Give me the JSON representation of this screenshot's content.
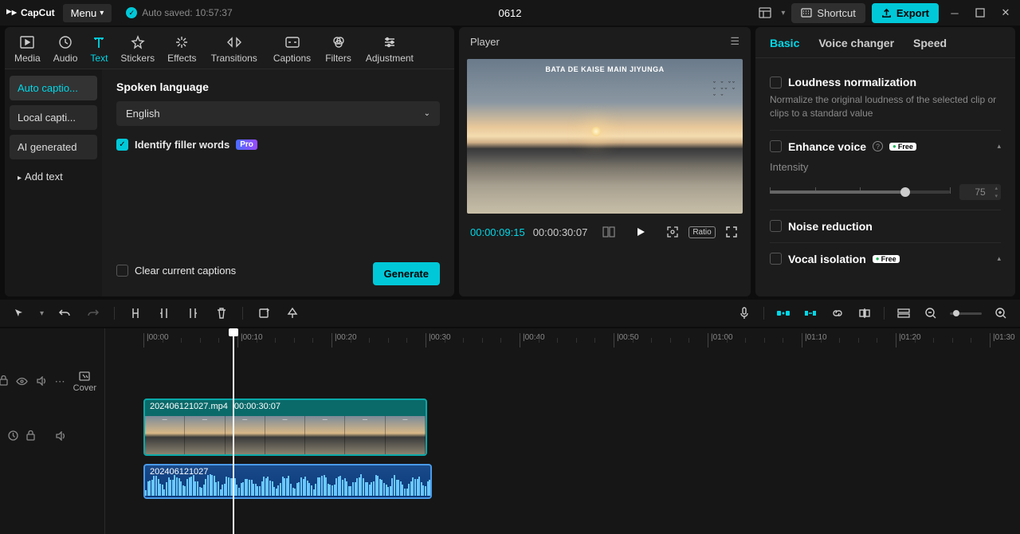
{
  "titlebar": {
    "app": "CapCut",
    "menu": "Menu",
    "autosave": "Auto saved: 10:57:37",
    "project": "0612",
    "shortcut": "Shortcut",
    "export": "Export"
  },
  "tooltabs": {
    "media": "Media",
    "audio": "Audio",
    "text": "Text",
    "stickers": "Stickers",
    "effects": "Effects",
    "transitions": "Transitions",
    "captions": "Captions",
    "filters": "Filters",
    "adjustment": "Adjustment"
  },
  "textSidebar": {
    "auto": "Auto captio...",
    "local": "Local capti...",
    "ai": "AI generated",
    "add": "Add text"
  },
  "captionForm": {
    "langLabel": "Spoken language",
    "lang": "English",
    "filler": "Identify filler words",
    "pro": "Pro",
    "clear": "Clear current captions",
    "generate": "Generate"
  },
  "player": {
    "title": "Player",
    "subtitle": "BATA DE KAISE MAIN JIYUNGA",
    "current": "00:00:09:15",
    "total": "00:00:30:07",
    "ratio": "Ratio"
  },
  "right": {
    "tabs": {
      "basic": "Basic",
      "voice": "Voice changer",
      "speed": "Speed"
    },
    "loudness": {
      "title": "Loudness normalization",
      "desc": "Normalize the original loudness of the selected clip or clips to a standard value"
    },
    "enhance": {
      "title": "Enhance voice",
      "free": "Free",
      "intensity": "Intensity",
      "value": "75"
    },
    "noise": {
      "title": "Noise reduction"
    },
    "vocal": {
      "title": "Vocal isolation",
      "free": "Free"
    }
  },
  "timeline": {
    "clip1_name": "202406121027.mp4",
    "clip1_dur": "00:00:30:07",
    "clip2_name": "202406121027",
    "cover": "Cover",
    "ruler": [
      "00:00",
      "00:10",
      "00:20",
      "00:30",
      "00:40",
      "00:50",
      "01:00",
      "01:10",
      "01:20",
      "01:30"
    ]
  }
}
